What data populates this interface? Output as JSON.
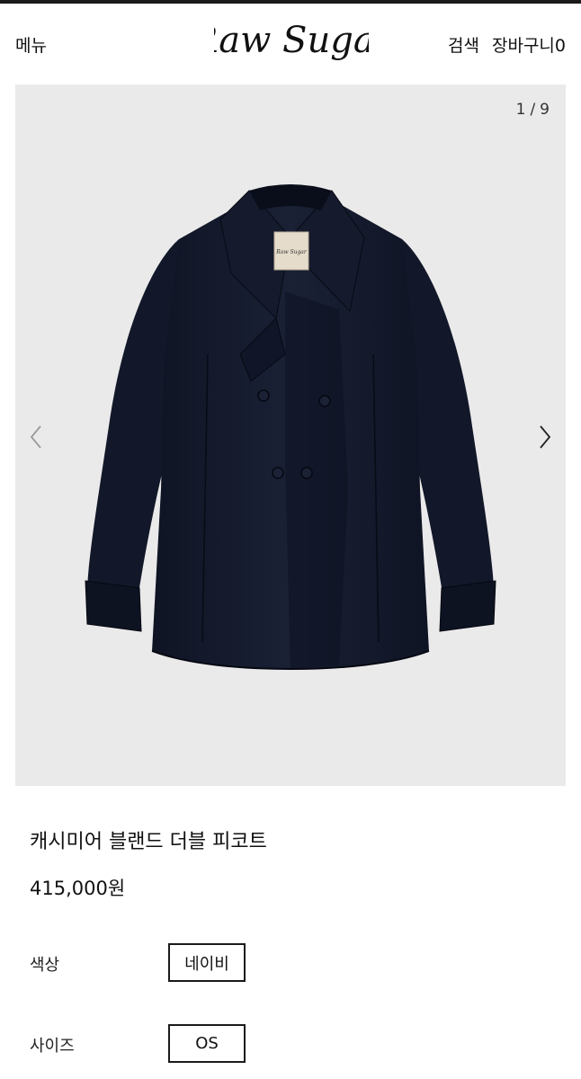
{
  "header": {
    "menu_label": "메뉴",
    "logo_text": "Raw Sugar",
    "search_label": "검색",
    "cart_label": "장바구니",
    "cart_count": "0"
  },
  "gallery": {
    "current": "1",
    "separator": "/",
    "total": "9",
    "label_text": "Raw Sugar",
    "prev_icon": "chevron-left-icon",
    "next_icon": "chevron-right-icon",
    "background": "#ebeaea",
    "coat_color": "#141a2b"
  },
  "product": {
    "name": "캐시미어 블랜드 더블 피코트",
    "price": "415,000원"
  },
  "options": {
    "color_label": "색상",
    "color_value": "네이비",
    "size_label": "사이즈",
    "size_value": "OS"
  }
}
